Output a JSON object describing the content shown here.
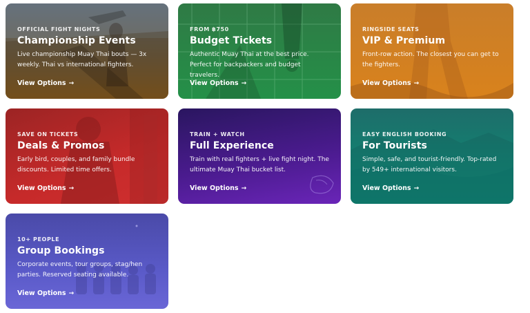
{
  "cards": [
    {
      "kicker": "OFFICIAL FIGHT NIGHTS",
      "title": "Championship Events",
      "desc1": "Live championship Muay Thai bouts — 3x",
      "desc2": "weekly. Thai vs international fighters.",
      "cta": "View Options",
      "arrow": "→"
    },
    {
      "kicker": "FROM ฿750",
      "title": "Budget Tickets",
      "desc1": "Authentic Muay Thai at the best price.",
      "desc2": "Perfect for backpackers and budget travelers.",
      "cta": "View Options",
      "arrow": "→"
    },
    {
      "kicker": "RINGSIDE SEATS",
      "title": "VIP & Premium",
      "desc1": "Front-row action. The closest you can get to",
      "desc2": "the fighters.",
      "cta": "View Options",
      "arrow": "→"
    },
    {
      "kicker": "SAVE ON TICKETS",
      "title": "Deals & Promos",
      "desc1": "Early bird, couples, and family bundle",
      "desc2": "discounts. Limited time offers.",
      "cta": "View Options",
      "arrow": "→"
    },
    {
      "kicker": "TRAIN + WATCH",
      "title": "Full Experience",
      "desc1": "Train with real fighters + live fight night. The",
      "desc2": "ultimate Muay Thai bucket list.",
      "cta": "View Options",
      "arrow": "→"
    },
    {
      "kicker": "EASY ENGLISH BOOKING",
      "title": "For Tourists",
      "desc1": "Simple, safe, and tourist-friendly. Top-rated",
      "desc2": "by 549+ international visitors.",
      "cta": "View Options",
      "arrow": "→"
    },
    {
      "kicker": "10+ PEOPLE",
      "title": "Group Bookings",
      "desc1": "Corporate events, tour groups, stag/hen",
      "desc2": "parties. Reserved seating available.",
      "cta": "View Options",
      "arrow": "→"
    }
  ]
}
